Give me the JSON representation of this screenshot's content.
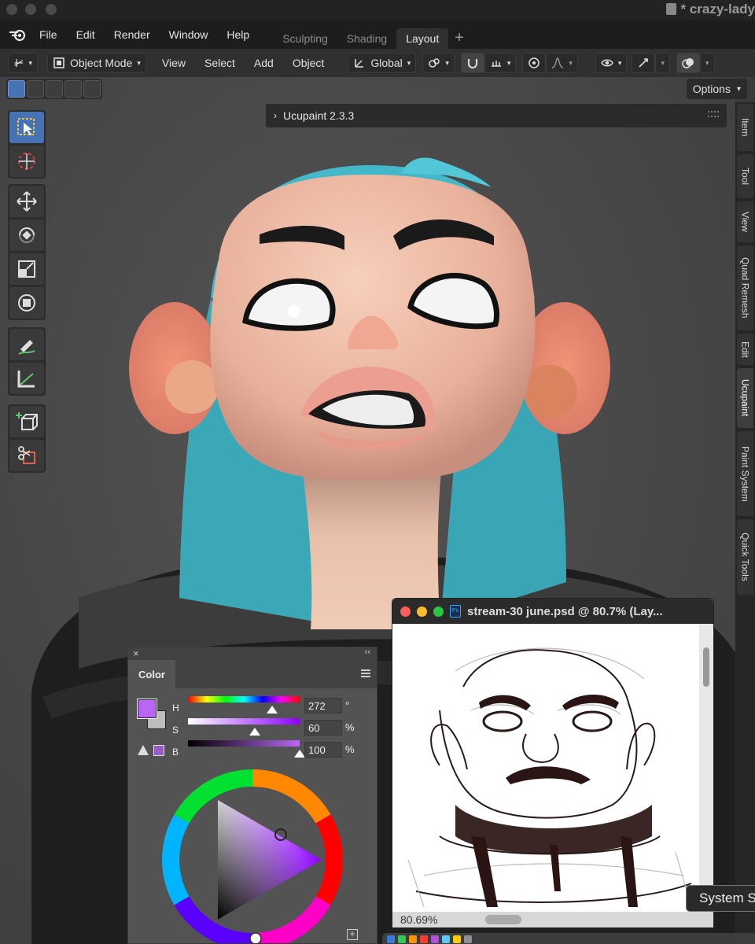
{
  "window": {
    "doc_title": "* crazy-lady"
  },
  "menubar": {
    "items": [
      "File",
      "Edit",
      "Render",
      "Window",
      "Help"
    ],
    "workspaces": [
      "Sculpting",
      "Shading",
      "Layout"
    ],
    "active_workspace": "Layout",
    "add_tab": "+"
  },
  "header": {
    "mode": "Object Mode",
    "menus": [
      "View",
      "Select",
      "Add",
      "Object"
    ],
    "transform_orientation": "Global"
  },
  "options_label": "Options",
  "ucupaint_label": "Ucupaint 2.3.3",
  "right_tabs": [
    "Item",
    "Tool",
    "View",
    "Quad Remesh",
    "Edit",
    "Ucupaint",
    "Paint System",
    "Quick Tools"
  ],
  "right_tab_active": "Ucupaint",
  "color_panel": {
    "tab": "Color",
    "h_label": "H",
    "h_value": "272",
    "h_unit": "°",
    "s_label": "S",
    "s_value": "60",
    "s_unit": "%",
    "b_label": "B",
    "b_value": "100",
    "b_unit": "%",
    "fg_color": "#b966f5",
    "h_fraction": 0.755,
    "s_fraction": 0.6,
    "b_fraction": 1.0
  },
  "ps_window": {
    "title": "stream-30 june.psd @ 80.7% (Lay...",
    "zoom_status": "80.69%"
  },
  "tooltip": "System S",
  "colors": {
    "accent": "#4772b3",
    "hair": "#3ab0c0",
    "skin": "#f0b8a0"
  }
}
